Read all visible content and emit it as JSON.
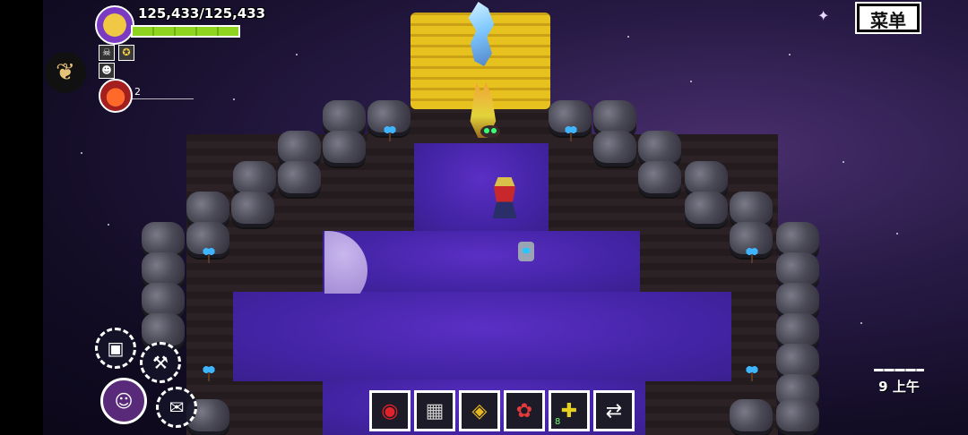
{
  "hud": {
    "hp_text": "125,433/125,433",
    "hp_fraction": 1.0,
    "pet_count": "2"
  },
  "menu": {
    "label": "菜单"
  },
  "clock": {
    "text": "9 上午"
  },
  "radial_tools": [
    {
      "name": "map-device",
      "glyph": "▣"
    },
    {
      "name": "hammer",
      "glyph": "⚒"
    },
    {
      "name": "character",
      "glyph": "☺"
    },
    {
      "name": "quest-scroll",
      "glyph": "✉"
    }
  ],
  "hotbar": [
    {
      "name": "red-orb",
      "glyph": "◉"
    },
    {
      "name": "net",
      "glyph": "▦"
    },
    {
      "name": "golden-relic",
      "glyph": "◈"
    },
    {
      "name": "red-creature",
      "glyph": "✿"
    },
    {
      "name": "shield-plus",
      "glyph": "✚",
      "badge": "8"
    },
    {
      "name": "swap-arrow",
      "glyph": "⇄"
    }
  ],
  "colors": {
    "hp": "#8fd41e",
    "water": "#4424a6",
    "hay": "#e7c21f"
  }
}
